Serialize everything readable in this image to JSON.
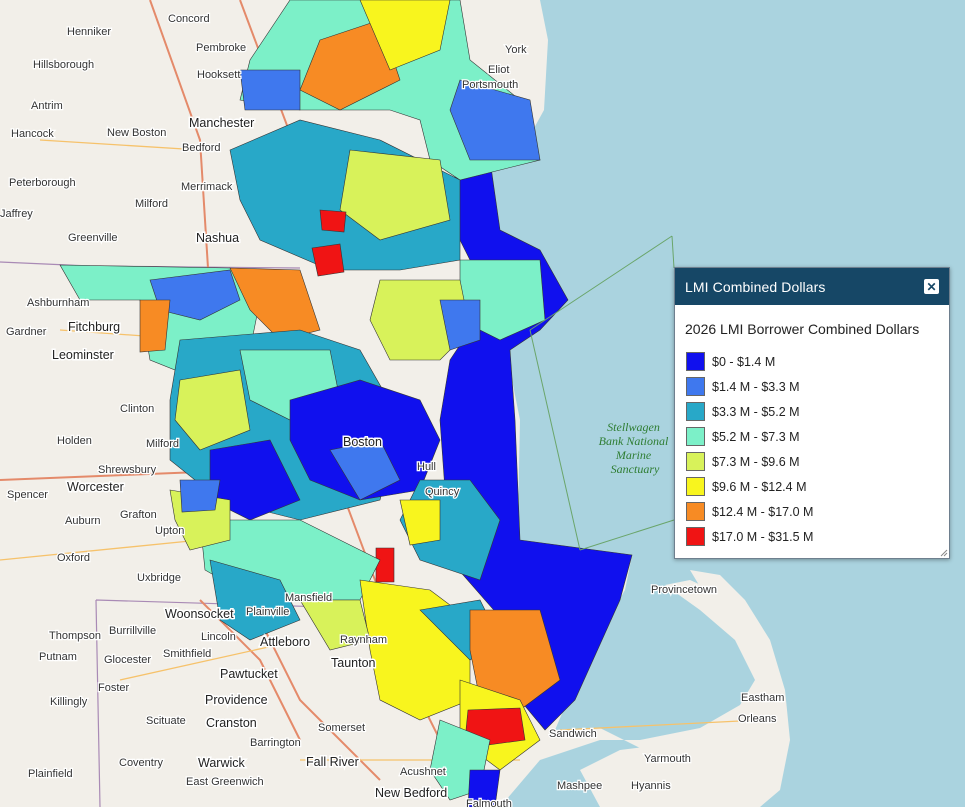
{
  "panel": {
    "title": "LMI Combined Dollars",
    "close_icon": "close-icon",
    "legend_title": "2026 LMI Borrower Combined Dollars",
    "classes": [
      {
        "label": "$0 - $1.4 M",
        "color": "#1010ee"
      },
      {
        "label": "$1.4 M - $3.3 M",
        "color": "#3f78ee"
      },
      {
        "label": "$3.3 M - $5.2 M",
        "color": "#28a8c8"
      },
      {
        "label": "$5.2 M - $7.3 M",
        "color": "#7cf0c8"
      },
      {
        "label": "$7.3 M - $9.6 M",
        "color": "#d8f25a"
      },
      {
        "label": "$9.6 M - $12.4 M",
        "color": "#f8f51e"
      },
      {
        "label": "$12.4 M - $17.0 M",
        "color": "#f78b24"
      },
      {
        "label": "$17.0 M - $31.5 M",
        "color": "#f01414"
      }
    ]
  },
  "map": {
    "marine_label_lines": [
      "Stellwagen",
      "Bank National",
      "Marine",
      "Sanctuary"
    ],
    "places": [
      "Concord",
      "Henniker",
      "Pembroke",
      "Hillsborough",
      "Hooksett",
      "Antrim",
      "Manchester",
      "Hancock",
      "New Boston",
      "Bedford",
      "Peterborough",
      "Merrimack",
      "Milford",
      "Jaffrey",
      "Greenville",
      "Nashua",
      "Ashburnham",
      "Fitchburg",
      "Gardner",
      "Leominster",
      "Clinton",
      "Holden",
      "Worcester",
      "Shrewsbury",
      "Spencer",
      "Auburn",
      "Grafton",
      "Upton",
      "Oxford",
      "Uxbridge",
      "Woonsocket",
      "Burrillville",
      "Thompson",
      "Glocester",
      "Smithfield",
      "Putnam",
      "Lincoln",
      "Foster",
      "Pawtucket",
      "Killingly",
      "Scituate",
      "Providence",
      "Cranston",
      "Coventry",
      "Warwick",
      "East Greenwich",
      "Plainfield",
      "Barrington",
      "Somerset",
      "Fall River",
      "Acushnet",
      "New Bedford",
      "Taunton",
      "Raynham",
      "Attleboro",
      "Mansfield",
      "Plainville",
      "Sandwich",
      "Mashpee",
      "Falmouth",
      "Yarmouth",
      "Hyannis",
      "Orleans",
      "Eastham",
      "Provincetown",
      "York",
      "Eliot",
      "Portsmouth",
      "Boston",
      "Quincy",
      "Hull",
      "Milford"
    ]
  }
}
